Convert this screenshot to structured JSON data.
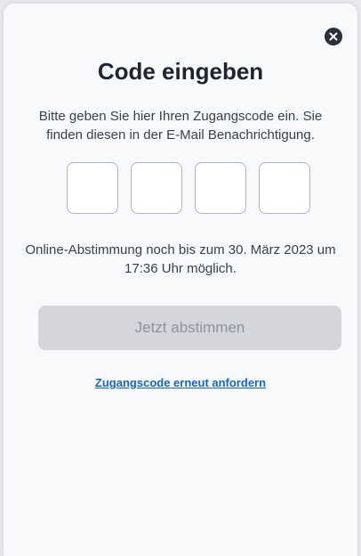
{
  "dialog": {
    "close_icon": "close-icon",
    "title": "Code eingeben",
    "description": "Bitte geben Sie hier Ihren Zugangscode ein. Sie finden diesen in der E-Mail Benachrichtigung.",
    "code_inputs": [
      {
        "value": ""
      },
      {
        "value": ""
      },
      {
        "value": ""
      },
      {
        "value": ""
      }
    ],
    "deadline_text": "Online-Abstimmung noch bis zum 30. März 2023 um 17:36 Uhr möglich.",
    "submit_label": "Jetzt abstimmen",
    "resend_link": "Zugangscode erneut anfordern"
  },
  "colors": {
    "accent": "#1463d6",
    "disabled_button": "#d4d6db",
    "close_button": "#2b2f3a"
  }
}
